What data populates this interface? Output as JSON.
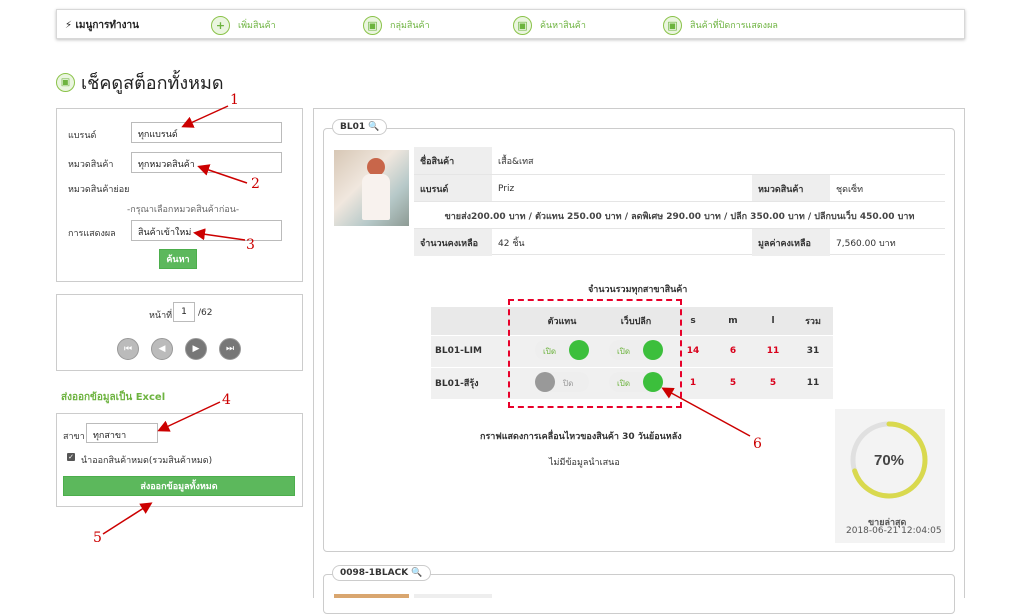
{
  "top_menu": {
    "title": "เมนูการทำงาน",
    "items": [
      {
        "label": "เพิ่มสินค้า",
        "icon": "plus-icon"
      },
      {
        "label": "กลุ่มสินค้า",
        "icon": "box-icon"
      },
      {
        "label": "ค้นหาสินค้า",
        "icon": "box-icon"
      },
      {
        "label": "สินค้าที่ปิดการแสดงผล",
        "icon": "box-icon"
      }
    ]
  },
  "page": {
    "title": "เช็คดูสต็อกทั้งหมด"
  },
  "filter": {
    "brand_label": "แบรนด์",
    "brand_value": "ทุกแบรนด์",
    "category_label": "หมวดสินค้า",
    "category_value": "ทุกหมวดสินค้า",
    "subcategory_label": "หมวดสินค้าย่อย",
    "subcategory_hint": "-กรุณาเลือกหมวดสินค้าก่อน-",
    "display_label": "การแสดงผล",
    "display_value": "สินค้าเข้าใหม่",
    "search_button": "ค้นหา"
  },
  "pagination": {
    "page_label": "หน้าที่",
    "current": "1",
    "total": "/62"
  },
  "excel": {
    "title": "ส่งออกข้อมูลเป็น Excel",
    "branch_label": "สาขา",
    "branch_value": "ทุกสาขา",
    "checkbox_label": "นำออกสินค้าหมด(รวมสินค้าหมด)",
    "export_button": "ส่งออกข้อมูลทั้งหมด"
  },
  "product": {
    "code": "BL01",
    "name_label": "ชื่อสินค้า",
    "name": "เสื้อ&เทส",
    "brand_label": "แบรนด์",
    "brand": "Priz",
    "category_label": "หมวดสินค้า",
    "category": "ชุดเซ็ท",
    "prices": "ขายส่ง200.00 บาท / ตัวแทน 250.00 บาท / ลดพิเศษ 290.00 บาท / ปลีก 350.00 บาท / ปลีกบนเว็บ 450.00 บาท",
    "remaining_label": "จำนวนคงเหลือ",
    "remaining": "42 ชิ้น",
    "value_label": "มูลค่าคงเหลือ",
    "value": "7,560.00 บาท",
    "table_title": "จำนวนรวมทุกสาขาสินค้า",
    "columns": [
      "",
      "ตัวแทน",
      "เว็บปลีก",
      "s",
      "m",
      "l",
      "รวม"
    ],
    "rows": [
      {
        "code": "BL01-LIM",
        "agent": "เปิด",
        "agent_on": true,
        "web": "เปิด",
        "web_on": true,
        "s": "14",
        "m": "6",
        "l": "11",
        "total": "31"
      },
      {
        "code": "BL01-สีรุ้ง",
        "agent": "ปิด",
        "agent_on": false,
        "web": "เปิด",
        "web_on": true,
        "s": "1",
        "m": "5",
        "l": "5",
        "total": "11"
      }
    ],
    "graph_title": "กราฟแสดงการเคลื่อนไหวของสินค้า 30 วันย้อนหลัง",
    "no_data": "ไม่มีข้อมูลนำเสนอ",
    "gauge_value": "70%",
    "gauge_fraction": 0.7,
    "last_sale_label": "ขายล่าสุด",
    "last_sale_date": "2018-06-21 12:04:05"
  },
  "next_product": {
    "code": "0098-1BLACK"
  },
  "annotations": [
    "1",
    "2",
    "3",
    "4",
    "5",
    "6"
  ],
  "colors": {
    "accent": "#6db33f",
    "button": "#5cb85c",
    "annotation": "#cc0000",
    "stock_red": "#d9001b"
  }
}
